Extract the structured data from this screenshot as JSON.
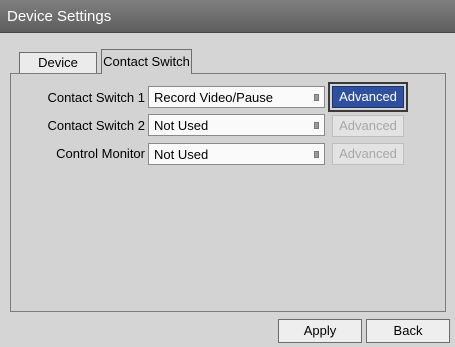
{
  "window": {
    "title": "Device Settings"
  },
  "tabs": [
    {
      "label": "Device",
      "active": false
    },
    {
      "label": "Contact Switch",
      "active": true
    }
  ],
  "rows": [
    {
      "label": "Contact Switch 1",
      "value": "Record Video/Pause",
      "advanced": "Advanced",
      "advanced_enabled": true
    },
    {
      "label": "Contact Switch 2",
      "value": "Not Used",
      "advanced": "Advanced",
      "advanced_enabled": false
    },
    {
      "label": "Control Monitor",
      "value": "Not Used",
      "advanced": "Advanced",
      "advanced_enabled": false
    }
  ],
  "buttons": {
    "apply": "Apply",
    "back": "Back"
  },
  "colors": {
    "titlebar": "#6a6a6a",
    "background": "#d5d5d5",
    "accent_button": "#2f4f9f",
    "disabled_text": "#a7a7a7"
  }
}
